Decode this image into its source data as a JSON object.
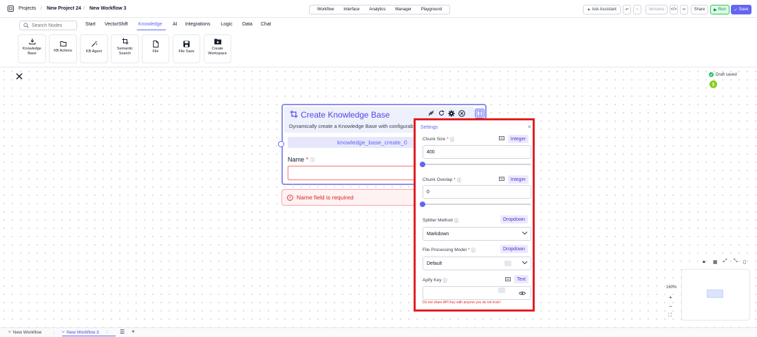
{
  "breadcrumb": {
    "projects": "Projects",
    "project": "New Project 24",
    "workflow": "New Workflow 3",
    "sep": "/"
  },
  "center_tabs": [
    "Workflow",
    "Interface",
    "Analytics",
    "Manager",
    "Playground"
  ],
  "toolbar": {
    "ask_assistant": "Ask Assistant",
    "versions": "Versions",
    "share": "Share",
    "run": "Run",
    "save": "Save"
  },
  "search": {
    "placeholder": "Search Nodes"
  },
  "categories": [
    "Start",
    "VectorShift",
    "Knowledge",
    "AI",
    "Integrations",
    "Logic",
    "Data",
    "Chat"
  ],
  "active_category": "Knowledge",
  "tiles": [
    {
      "label": "Knowledge\nBase",
      "icon": "download-icon"
    },
    {
      "label": "KB Actions",
      "icon": "folder-icon"
    },
    {
      "label": "KB Agent",
      "icon": "magic-wand-icon"
    },
    {
      "label": "Semantic\nSearch",
      "icon": "crop-icon"
    },
    {
      "label": "File",
      "icon": "file-icon"
    },
    {
      "label": "File Save",
      "icon": "floppy-icon"
    },
    {
      "label": "Create\nWorkspace",
      "icon": "folder-plus-icon"
    }
  ],
  "node": {
    "title": "Create Knowledge Base",
    "description": "Dynamically create a Knowledge Base with configurable",
    "id": "knowledge_base_create_0",
    "name_label": "Name",
    "error": "Name field is required"
  },
  "settings": {
    "title": "Settings",
    "chunk_size": {
      "label": "Chunk Size",
      "type": "Integer",
      "value": "400",
      "slider": 0.0
    },
    "chunk_overlap": {
      "label": "Chunk Overlap",
      "type": "Integer",
      "value": "0",
      "slider": 0.0
    },
    "splitter": {
      "label": "Splitter Method",
      "type": "Dropdown",
      "value": "Markdown"
    },
    "file_model": {
      "label": "File Processing Model",
      "type": "Dropdown",
      "value": "Default"
    },
    "apify_key": {
      "label": "Apify Key",
      "type": "Text",
      "value": "",
      "warning": "Do not share API Key with anyone you do not trust !"
    }
  },
  "status": {
    "draft": "Draft saved"
  },
  "zoom": {
    "level": "160%"
  },
  "bottom_tabs": [
    {
      "label": "New Workflow",
      "active": false
    },
    {
      "label": "New Workflow 3",
      "active": true
    }
  ],
  "colors": {
    "accent": "#6366f1",
    "error": "#dc2626",
    "run": "#22c55e",
    "highlight_border": "#e11d22"
  }
}
